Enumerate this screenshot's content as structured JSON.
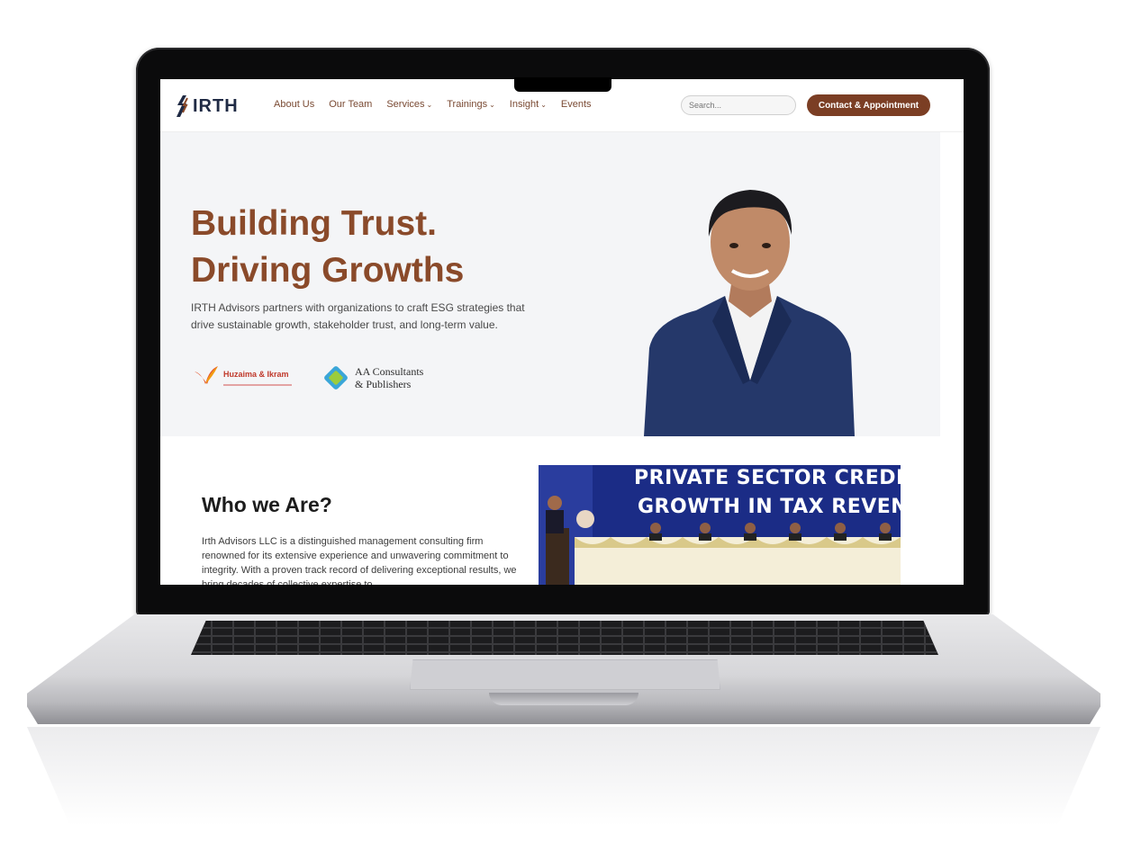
{
  "nav": {
    "logo_text": "IRTH",
    "links": [
      {
        "label": "About Us",
        "dropdown": false
      },
      {
        "label": "Our Team",
        "dropdown": false
      },
      {
        "label": "Services",
        "dropdown": true
      },
      {
        "label": "Trainings",
        "dropdown": true
      },
      {
        "label": "Insight",
        "dropdown": true
      },
      {
        "label": "Events",
        "dropdown": false
      }
    ],
    "search_placeholder": "Search...",
    "cta_label": "Contact & Appointment"
  },
  "hero": {
    "title_line1": "Building Trust.",
    "title_line2": "Driving Growths",
    "description": "IRTH Advisors partners with organizations to craft ESG strategies that drive sustainable growth, stakeholder trust, and long-term value.",
    "partners": [
      {
        "name": "Huzaima & Ikram"
      },
      {
        "name_line1": "AA Consultants",
        "name_line2": "& Publishers"
      }
    ]
  },
  "who": {
    "title": "Who we Are?",
    "text": "Irth Advisors LLC is a distinguished management consulting firm renowned for its extensive experience and unwavering commitment to integrity. With a proven track record of delivering exceptional results, we bring decades of collective expertise to"
  },
  "event_banner": {
    "line1": "PRIVATE SECTOR CREDIT",
    "line2": "GROWTH IN TAX REVENU"
  },
  "colors": {
    "brand_brown": "#8a4a2a",
    "cta_brown": "#7b3e24",
    "navy": "#1f2a44",
    "banner_blue": "#1b2c86"
  }
}
